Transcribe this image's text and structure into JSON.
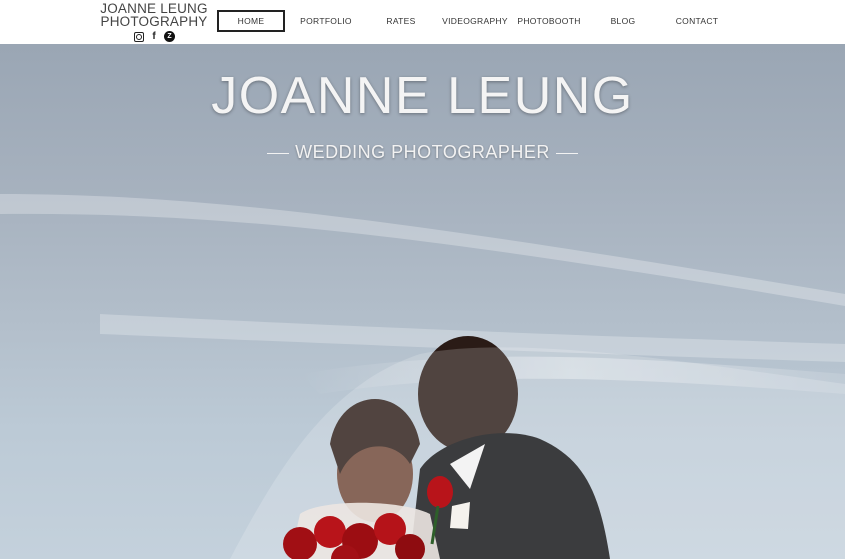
{
  "brand": {
    "line1": "JOANNE LEUNG",
    "line2": "PHOTOGRAPHY"
  },
  "social": [
    {
      "name": "instagram-icon"
    },
    {
      "name": "facebook-icon",
      "glyph": "f"
    },
    {
      "name": "zola-icon",
      "glyph": "Z"
    }
  ],
  "nav": {
    "active": "HOME",
    "items": [
      {
        "label": "HOME"
      },
      {
        "label": "PORTFOLIO"
      },
      {
        "label": "RATES"
      },
      {
        "label": "VIDEOGRAPHY"
      },
      {
        "label": "PHOTOBOOTH"
      },
      {
        "label": "BLOG"
      },
      {
        "label": "CONTACT"
      }
    ]
  },
  "hero": {
    "title": "JOANNE LEUNG",
    "subtitle": "WEDDING PHOTOGRAPHER"
  }
}
